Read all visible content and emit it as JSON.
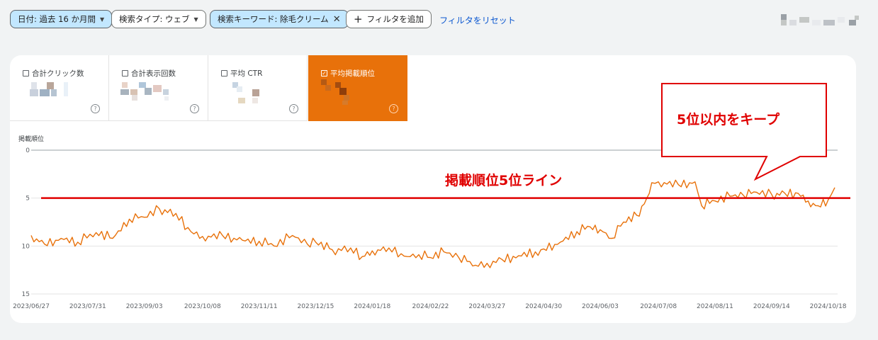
{
  "filters": {
    "date": "日付: 過去 16 か月間",
    "search_type": "検索タイプ: ウェブ",
    "keyword": "検索キーワード: 除毛クリーム",
    "add_filter": "フィルタを追加",
    "reset": "フィルタをリセット"
  },
  "metrics": [
    {
      "label": "合計クリック数",
      "checked": false
    },
    {
      "label": "合計表示回数",
      "checked": false
    },
    {
      "label": "平均 CTR",
      "checked": false
    },
    {
      "label": "平均掲載順位",
      "checked": true
    }
  ],
  "colors": {
    "accent": "#e8710a",
    "annotation": "#e00000",
    "chip_selected": "#c2e7ff"
  },
  "annotations": {
    "callout": "5位以内をキープ",
    "line_label": "掲載順位5位ライン",
    "line_value": 5
  },
  "chart_data": {
    "type": "line",
    "ylabel": "掲載順位",
    "y_reversed": true,
    "ylim": [
      0,
      15
    ],
    "yticks": [
      0,
      5,
      10,
      15
    ],
    "x_ticks": [
      "2023/06/27",
      "2023/07/31",
      "2023/09/03",
      "2023/10/08",
      "2023/11/11",
      "2023/12/15",
      "2024/01/18",
      "2024/02/22",
      "2024/03/27",
      "2024/04/30",
      "2024/06/03",
      "2024/07/08",
      "2024/08/11",
      "2024/09/14",
      "2024/10/18"
    ],
    "x_range": [
      "2023/06/27",
      "2024/10/22"
    ],
    "grid": true,
    "series": [
      {
        "color": "#e8710a",
        "points": [
          [
            "2023/06/27",
            8.9
          ],
          [
            "2023/07/05",
            9.8
          ],
          [
            "2023/07/15",
            9.2
          ],
          [
            "2023/07/25",
            9.6
          ],
          [
            "2023/08/05",
            8.6
          ],
          [
            "2023/08/15",
            9.2
          ],
          [
            "2023/08/25",
            7.2
          ],
          [
            "2023/09/03",
            7.0
          ],
          [
            "2023/09/12",
            6.1
          ],
          [
            "2023/09/22",
            6.6
          ],
          [
            "2023/10/01",
            8.5
          ],
          [
            "2023/10/08",
            9.0
          ],
          [
            "2023/10/20",
            8.9
          ],
          [
            "2023/11/01",
            9.4
          ],
          [
            "2023/11/11",
            9.5
          ],
          [
            "2023/11/20",
            10.0
          ],
          [
            "2023/12/01",
            8.9
          ],
          [
            "2023/12/10",
            9.8
          ],
          [
            "2023/12/15",
            9.6
          ],
          [
            "2023/12/25",
            10.4
          ],
          [
            "2024/01/05",
            10.2
          ],
          [
            "2024/01/12",
            11.1
          ],
          [
            "2024/01/18",
            10.5
          ],
          [
            "2024/01/28",
            10.2
          ],
          [
            "2024/02/08",
            11.1
          ],
          [
            "2024/02/15",
            10.9
          ],
          [
            "2024/02/22",
            11.2
          ],
          [
            "2024/03/01",
            10.6
          ],
          [
            "2024/03/10",
            11.2
          ],
          [
            "2024/03/20",
            12.0
          ],
          [
            "2024/03/27",
            11.8
          ],
          [
            "2024/04/05",
            11.4
          ],
          [
            "2024/04/15",
            11.0
          ],
          [
            "2024/04/25",
            10.6
          ],
          [
            "2024/04/30",
            10.3
          ],
          [
            "2024/05/10",
            9.6
          ],
          [
            "2024/05/20",
            8.5
          ],
          [
            "2024/05/28",
            8.0
          ],
          [
            "2024/06/03",
            8.3
          ],
          [
            "2024/06/10",
            9.2
          ],
          [
            "2024/06/17",
            7.5
          ],
          [
            "2024/06/25",
            6.8
          ],
          [
            "2024/07/01",
            5.0
          ],
          [
            "2024/07/04",
            3.4
          ],
          [
            "2024/07/08",
            3.3
          ],
          [
            "2024/07/20",
            3.6
          ],
          [
            "2024/07/30",
            3.3
          ],
          [
            "2024/08/03",
            5.8
          ],
          [
            "2024/08/11",
            5.3
          ],
          [
            "2024/08/20",
            4.8
          ],
          [
            "2024/08/28",
            4.7
          ],
          [
            "2024/09/05",
            4.4
          ],
          [
            "2024/09/14",
            4.6
          ],
          [
            "2024/09/22",
            4.5
          ],
          [
            "2024/09/30",
            4.5
          ],
          [
            "2024/10/06",
            5.3
          ],
          [
            "2024/10/12",
            5.8
          ],
          [
            "2024/10/18",
            5.2
          ],
          [
            "2024/10/22",
            3.9
          ]
        ]
      }
    ]
  }
}
